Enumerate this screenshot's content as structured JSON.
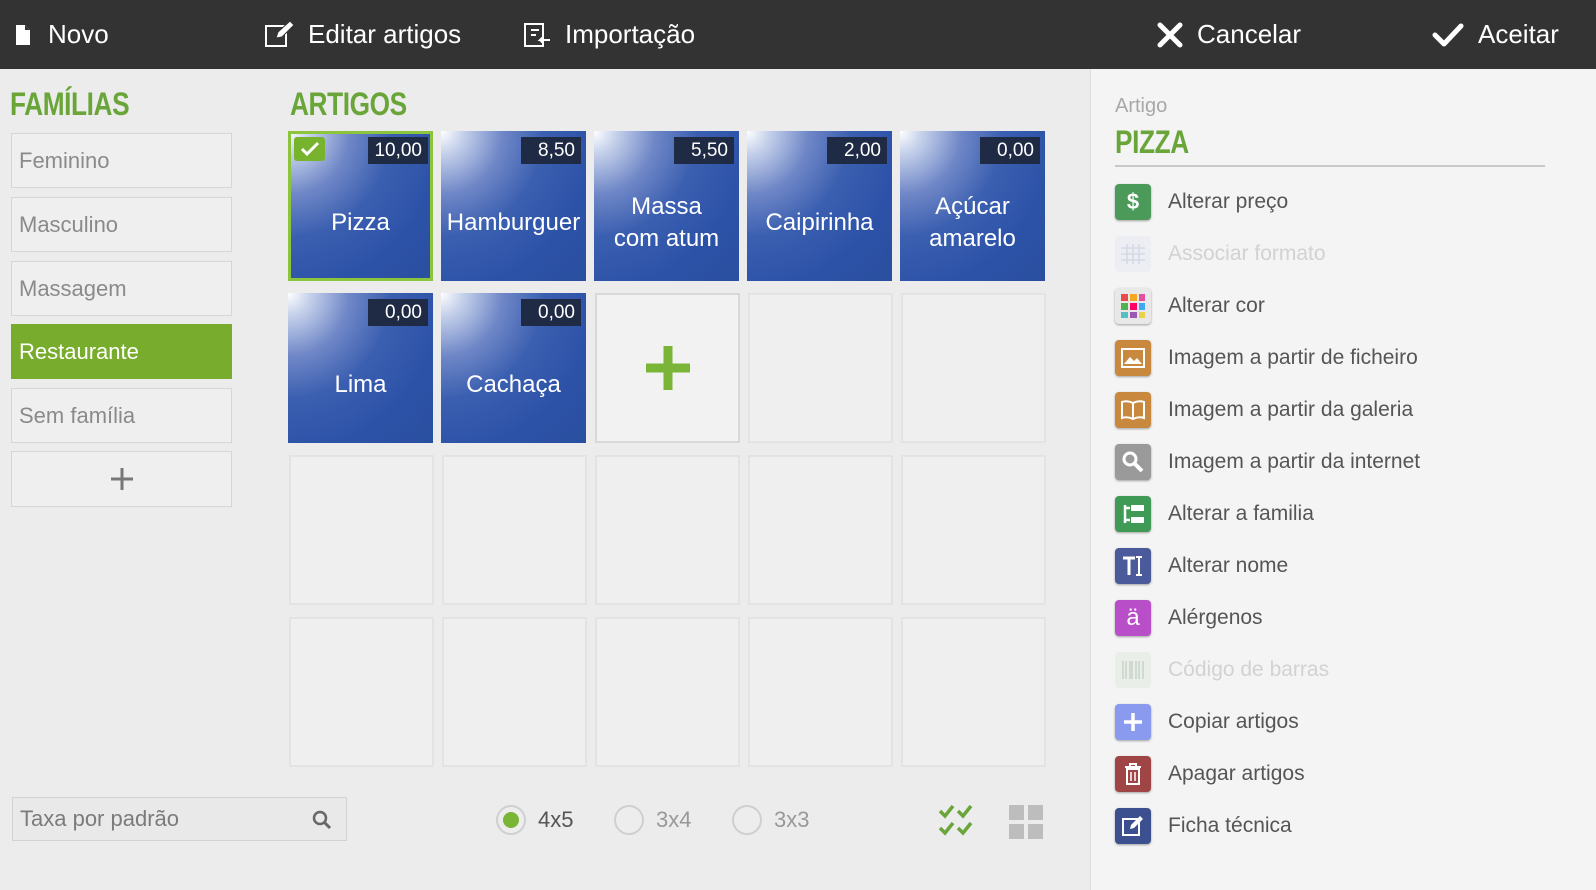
{
  "toolbar": {
    "new_label": "Novo",
    "edit_label": "Editar artigos",
    "import_label": "Importação",
    "cancel_label": "Cancelar",
    "accept_label": "Aceitar"
  },
  "families": {
    "title": "FAMÍLIAS",
    "items": [
      {
        "label": "Feminino",
        "active": false
      },
      {
        "label": "Masculino",
        "active": false
      },
      {
        "label": "Massagem",
        "active": false
      },
      {
        "label": "Restaurante",
        "active": true
      },
      {
        "label": "Sem família",
        "active": false
      }
    ]
  },
  "articles": {
    "title": "ARTIGOS",
    "items": [
      {
        "name": "Pizza",
        "price": "10,00",
        "selected": true
      },
      {
        "name": "Hamburguer",
        "price": "8,50",
        "selected": false
      },
      {
        "name": "Massa com atum",
        "price": "5,50",
        "selected": false
      },
      {
        "name": "Caipirinha",
        "price": "2,00",
        "selected": false
      },
      {
        "name": "Açúcar amarelo",
        "price": "0,00",
        "selected": false
      },
      {
        "name": "Lima",
        "price": "0,00",
        "selected": false
      },
      {
        "name": "Cachaça",
        "price": "0,00",
        "selected": false
      }
    ]
  },
  "bottom": {
    "tax_value": "Taxa por padrão",
    "layouts": [
      {
        "label": "4x5",
        "selected": true
      },
      {
        "label": "3x4",
        "selected": false
      },
      {
        "label": "3x3",
        "selected": false
      }
    ]
  },
  "detail": {
    "caption": "Artigo",
    "name": "PIZZA",
    "actions": [
      {
        "label": "Alterar preço",
        "icon": "dollar-icon",
        "color": "#4c9a5a",
        "enabled": true
      },
      {
        "label": "Associar formato",
        "icon": "format-grid-icon",
        "color": "#b8c4e0",
        "enabled": false
      },
      {
        "label": "Alterar cor",
        "icon": "color-palette-icon",
        "color": "#e8e8e8",
        "enabled": true
      },
      {
        "label": "Imagem a partir de ficheiro",
        "icon": "image-file-icon",
        "color": "#c8893e",
        "enabled": true
      },
      {
        "label": "Imagem a partir da galeria",
        "icon": "gallery-book-icon",
        "color": "#c8893e",
        "enabled": true
      },
      {
        "label": "Imagem a partir da internet",
        "icon": "magnifier-icon",
        "color": "#9a9a9a",
        "enabled": true
      },
      {
        "label": "Alterar a familia",
        "icon": "family-tree-icon",
        "color": "#3e9a55",
        "enabled": true
      },
      {
        "label": "Alterar nome",
        "icon": "text-cursor-icon",
        "color": "#4a5a9a",
        "enabled": true
      },
      {
        "label": "Alérgenos",
        "icon": "allergen-icon",
        "color": "#b84fc8",
        "enabled": true
      },
      {
        "label": "Código de barras",
        "icon": "barcode-icon",
        "color": "#b5c9b5",
        "enabled": false
      },
      {
        "label": "Copiar artigos",
        "icon": "copy-plus-icon",
        "color": "#8a9bef",
        "enabled": true
      },
      {
        "label": "Apagar artigos",
        "icon": "trash-icon",
        "color": "#a04545",
        "enabled": true
      },
      {
        "label": "Ficha técnica",
        "icon": "edit-sheet-icon",
        "color": "#3c4f8f",
        "enabled": true
      }
    ]
  }
}
